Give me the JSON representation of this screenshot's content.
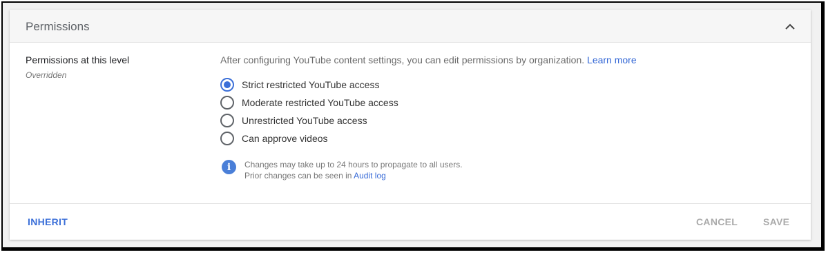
{
  "panel": {
    "title": "Permissions",
    "collapse_icon": "chevron-up-icon"
  },
  "level": {
    "label": "Permissions at this level",
    "status": "Overridden"
  },
  "description": {
    "text": "After configuring YouTube content settings, you can edit permissions by organization.",
    "link": "Learn more"
  },
  "options": [
    {
      "label": "Strict restricted YouTube access",
      "selected": true
    },
    {
      "label": "Moderate restricted YouTube access",
      "selected": false
    },
    {
      "label": "Unrestricted YouTube access",
      "selected": false
    },
    {
      "label": "Can approve videos",
      "selected": false
    }
  ],
  "note": {
    "icon": "info-icon",
    "line1": "Changes may take up to 24 hours to propagate to all users.",
    "line2_prefix": "Prior changes can be seen in",
    "line2_link": "Audit log"
  },
  "footer": {
    "inherit_label": "INHERIT",
    "cancel_label": "CANCEL",
    "save_label": "SAVE"
  },
  "colors": {
    "accent": "#3b6fd8",
    "link": "#3367d6",
    "disabled": "#aaaaaa"
  }
}
